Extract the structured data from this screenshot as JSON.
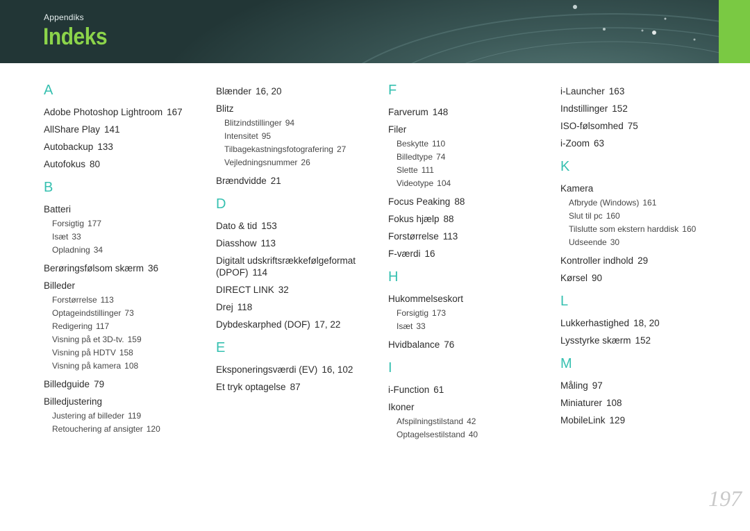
{
  "header": {
    "section": "Appendiks",
    "title": "Indeks"
  },
  "page_number": "197",
  "columns": [
    [
      {
        "letter": "A",
        "entries": [
          {
            "term": "Adobe Photoshop Lightroom",
            "pages": "167"
          },
          {
            "term": "AllShare Play",
            "pages": "141"
          },
          {
            "term": "Autobackup",
            "pages": "133"
          },
          {
            "term": "Autofokus",
            "pages": "80"
          }
        ]
      },
      {
        "letter": "B",
        "entries": [
          {
            "term": "Batteri",
            "pages": "",
            "subs": [
              {
                "term": "Forsigtig",
                "pages": "177"
              },
              {
                "term": "Isæt",
                "pages": "33"
              },
              {
                "term": "Opladning",
                "pages": "34"
              }
            ]
          },
          {
            "term": "Berøringsfølsom skærm",
            "pages": "36"
          },
          {
            "term": "Billeder",
            "pages": "",
            "subs": [
              {
                "term": "Forstørrelse",
                "pages": "113"
              },
              {
                "term": "Optageindstillinger",
                "pages": "73"
              },
              {
                "term": "Redigering",
                "pages": "117"
              },
              {
                "term": "Visning på et 3D-tv.",
                "pages": "159"
              },
              {
                "term": "Visning på HDTV",
                "pages": "158"
              },
              {
                "term": "Visning på kamera",
                "pages": "108"
              }
            ]
          },
          {
            "term": "Billedguide",
            "pages": "79"
          },
          {
            "term": "Billedjustering",
            "pages": "",
            "subs": [
              {
                "term": "Justering af billeder",
                "pages": "119"
              },
              {
                "term": "Retouchering af ansigter",
                "pages": "120"
              }
            ]
          }
        ]
      }
    ],
    [
      {
        "letter": "",
        "entries": [
          {
            "term": "Blænder",
            "pages": "16, 20"
          },
          {
            "term": "Blitz",
            "pages": "",
            "subs": [
              {
                "term": "Blitzindstillinger",
                "pages": "94"
              },
              {
                "term": "Intensitet",
                "pages": "95"
              },
              {
                "term": "Tilbagekastningsfotografering",
                "pages": "27"
              },
              {
                "term": "Vejledningsnummer",
                "pages": "26"
              }
            ]
          },
          {
            "term": "Brændvidde",
            "pages": "21"
          }
        ]
      },
      {
        "letter": "D",
        "entries": [
          {
            "term": "Dato & tid",
            "pages": "153"
          },
          {
            "term": "Diasshow",
            "pages": "113"
          },
          {
            "term": "Digitalt udskriftsrækkefølgeformat (DPOF)",
            "pages": "114"
          },
          {
            "term": "DIRECT LINK",
            "pages": "32"
          },
          {
            "term": "Drej",
            "pages": "118"
          },
          {
            "term": "Dybdeskarphed (DOF)",
            "pages": "17, 22"
          }
        ]
      },
      {
        "letter": "E",
        "entries": [
          {
            "term": "Eksponeringsværdi (EV)",
            "pages": "16, 102"
          },
          {
            "term": "Et tryk optagelse",
            "pages": "87"
          }
        ]
      }
    ],
    [
      {
        "letter": "F",
        "entries": [
          {
            "term": "Farverum",
            "pages": "148"
          },
          {
            "term": "Filer",
            "pages": "",
            "subs": [
              {
                "term": "Beskytte",
                "pages": "110"
              },
              {
                "term": "Billedtype",
                "pages": "74"
              },
              {
                "term": "Slette",
                "pages": "111"
              },
              {
                "term": "Videotype",
                "pages": "104"
              }
            ]
          },
          {
            "term": "Focus Peaking",
            "pages": "88"
          },
          {
            "term": "Fokus hjælp",
            "pages": "88"
          },
          {
            "term": "Forstørrelse",
            "pages": "113"
          },
          {
            "term": "F-værdi",
            "pages": "16"
          }
        ]
      },
      {
        "letter": "H",
        "entries": [
          {
            "term": "Hukommelseskort",
            "pages": "",
            "subs": [
              {
                "term": "Forsigtig",
                "pages": "173"
              },
              {
                "term": "Isæt",
                "pages": "33"
              }
            ]
          },
          {
            "term": "Hvidbalance",
            "pages": "76"
          }
        ]
      },
      {
        "letter": "I",
        "entries": [
          {
            "term": "i-Function",
            "pages": "61"
          },
          {
            "term": "Ikoner",
            "pages": "",
            "subs": [
              {
                "term": "Afspilningstilstand",
                "pages": "42"
              },
              {
                "term": "Optagelsestilstand",
                "pages": "40"
              }
            ]
          }
        ]
      }
    ],
    [
      {
        "letter": "",
        "entries": [
          {
            "term": "i-Launcher",
            "pages": "163"
          },
          {
            "term": "Indstillinger",
            "pages": "152"
          },
          {
            "term": "ISO-følsomhed",
            "pages": "75"
          },
          {
            "term": "i-Zoom",
            "pages": "63"
          }
        ]
      },
      {
        "letter": "K",
        "entries": [
          {
            "term": "Kamera",
            "pages": "",
            "subs": [
              {
                "term": "Afbryde (Windows)",
                "pages": "161"
              },
              {
                "term": "Slut til pc",
                "pages": "160"
              },
              {
                "term": "Tilslutte som ekstern harddisk",
                "pages": "160"
              },
              {
                "term": "Udseende",
                "pages": "30"
              }
            ]
          },
          {
            "term": "Kontroller indhold",
            "pages": "29"
          },
          {
            "term": "Kørsel",
            "pages": "90"
          }
        ]
      },
      {
        "letter": "L",
        "entries": [
          {
            "term": "Lukkerhastighed",
            "pages": "18, 20"
          },
          {
            "term": "Lysstyrke skærm",
            "pages": "152"
          }
        ]
      },
      {
        "letter": "M",
        "entries": [
          {
            "term": "Måling",
            "pages": "97"
          },
          {
            "term": "Miniaturer",
            "pages": "108"
          },
          {
            "term": "MobileLink",
            "pages": "129"
          }
        ]
      }
    ]
  ]
}
